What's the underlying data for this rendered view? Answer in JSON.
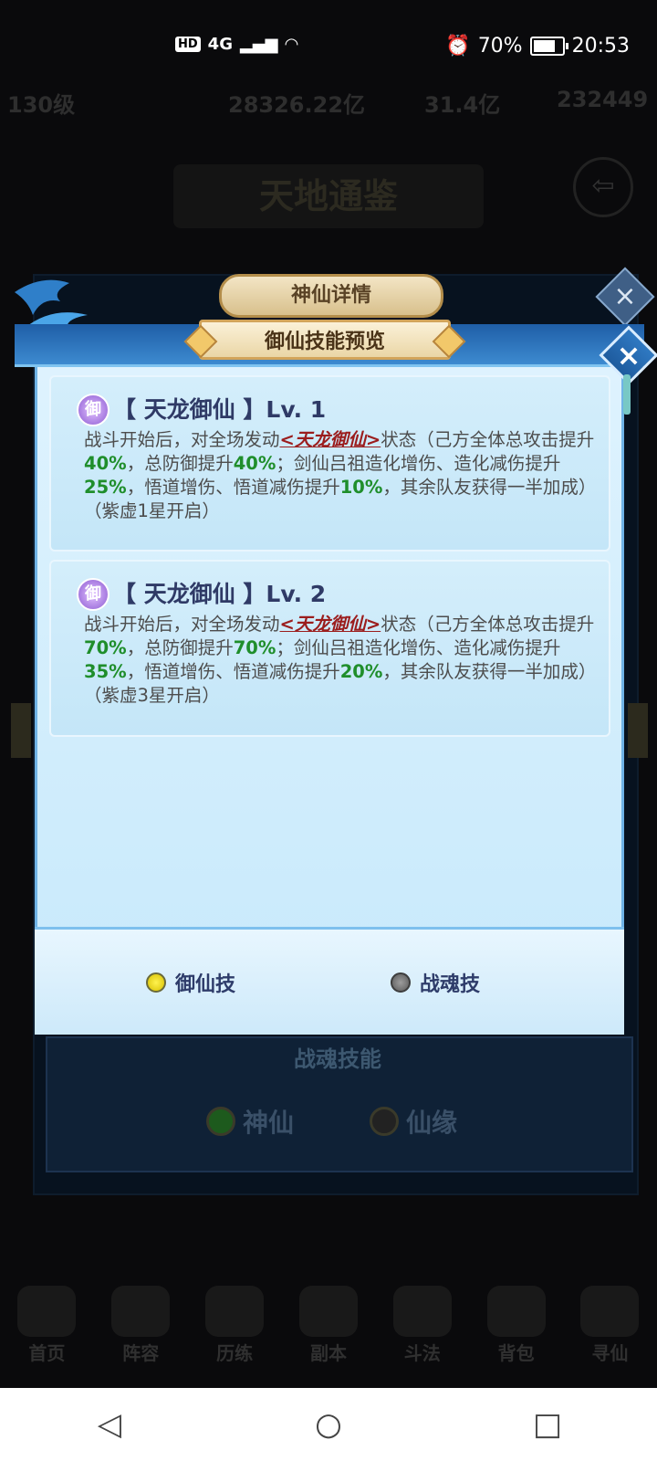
{
  "status_bar": {
    "network": "HD",
    "signal": "4G",
    "battery_pct": "70%",
    "time": "20:53"
  },
  "background": {
    "level": "130级",
    "stats": [
      "28326.22亿",
      "31.4亿",
      "232449"
    ],
    "title": "天地通鉴",
    "panel_header": "神仙详情",
    "section_title": "战魂技能",
    "options": [
      "神仙",
      "仙缘"
    ],
    "nav": [
      "首页",
      "阵容",
      "历练",
      "副本",
      "斗法",
      "背包",
      "寻仙"
    ]
  },
  "dialog": {
    "header": "御仙技能预览",
    "skills": [
      {
        "badge": "御",
        "title": "【 天龙御仙 】Lv. 1",
        "desc": {
          "p1": "战斗开始后，对全场发动",
          "state": "<天龙御仙>",
          "p2": "状态（己方全体总攻击提升",
          "v1": "40%",
          "p3": "，总防御提升",
          "v2": "40%",
          "p4": "；剑仙吕祖造化增伤、造化减伤提升",
          "v3": "25%",
          "p5": "，悟道增伤、悟道减伤提升",
          "v4": "10%",
          "p6": "，其余队友获得一半加成）（紫虚1星开启）"
        }
      },
      {
        "badge": "御",
        "title": "【 天龙御仙 】Lv. 2",
        "desc": {
          "p1": "战斗开始后，对全场发动",
          "state": "<天龙御仙>",
          "p2": "状态（己方全体总攻击提升",
          "v1": "70%",
          "p3": "，总防御提升",
          "v2": "70%",
          "p4": "；剑仙吕祖造化增伤、造化减伤提升",
          "v3": "35%",
          "p5": "，悟道增伤、悟道减伤提升",
          "v4": "20%",
          "p6": "，其余队友获得一半加成）（紫虚3星开启）"
        }
      }
    ],
    "tabs": [
      {
        "label": "御仙技",
        "selected": true
      },
      {
        "label": "战魂技",
        "selected": false
      }
    ]
  },
  "navbar": {
    "back": "◁",
    "home": "○",
    "recents": "□"
  }
}
